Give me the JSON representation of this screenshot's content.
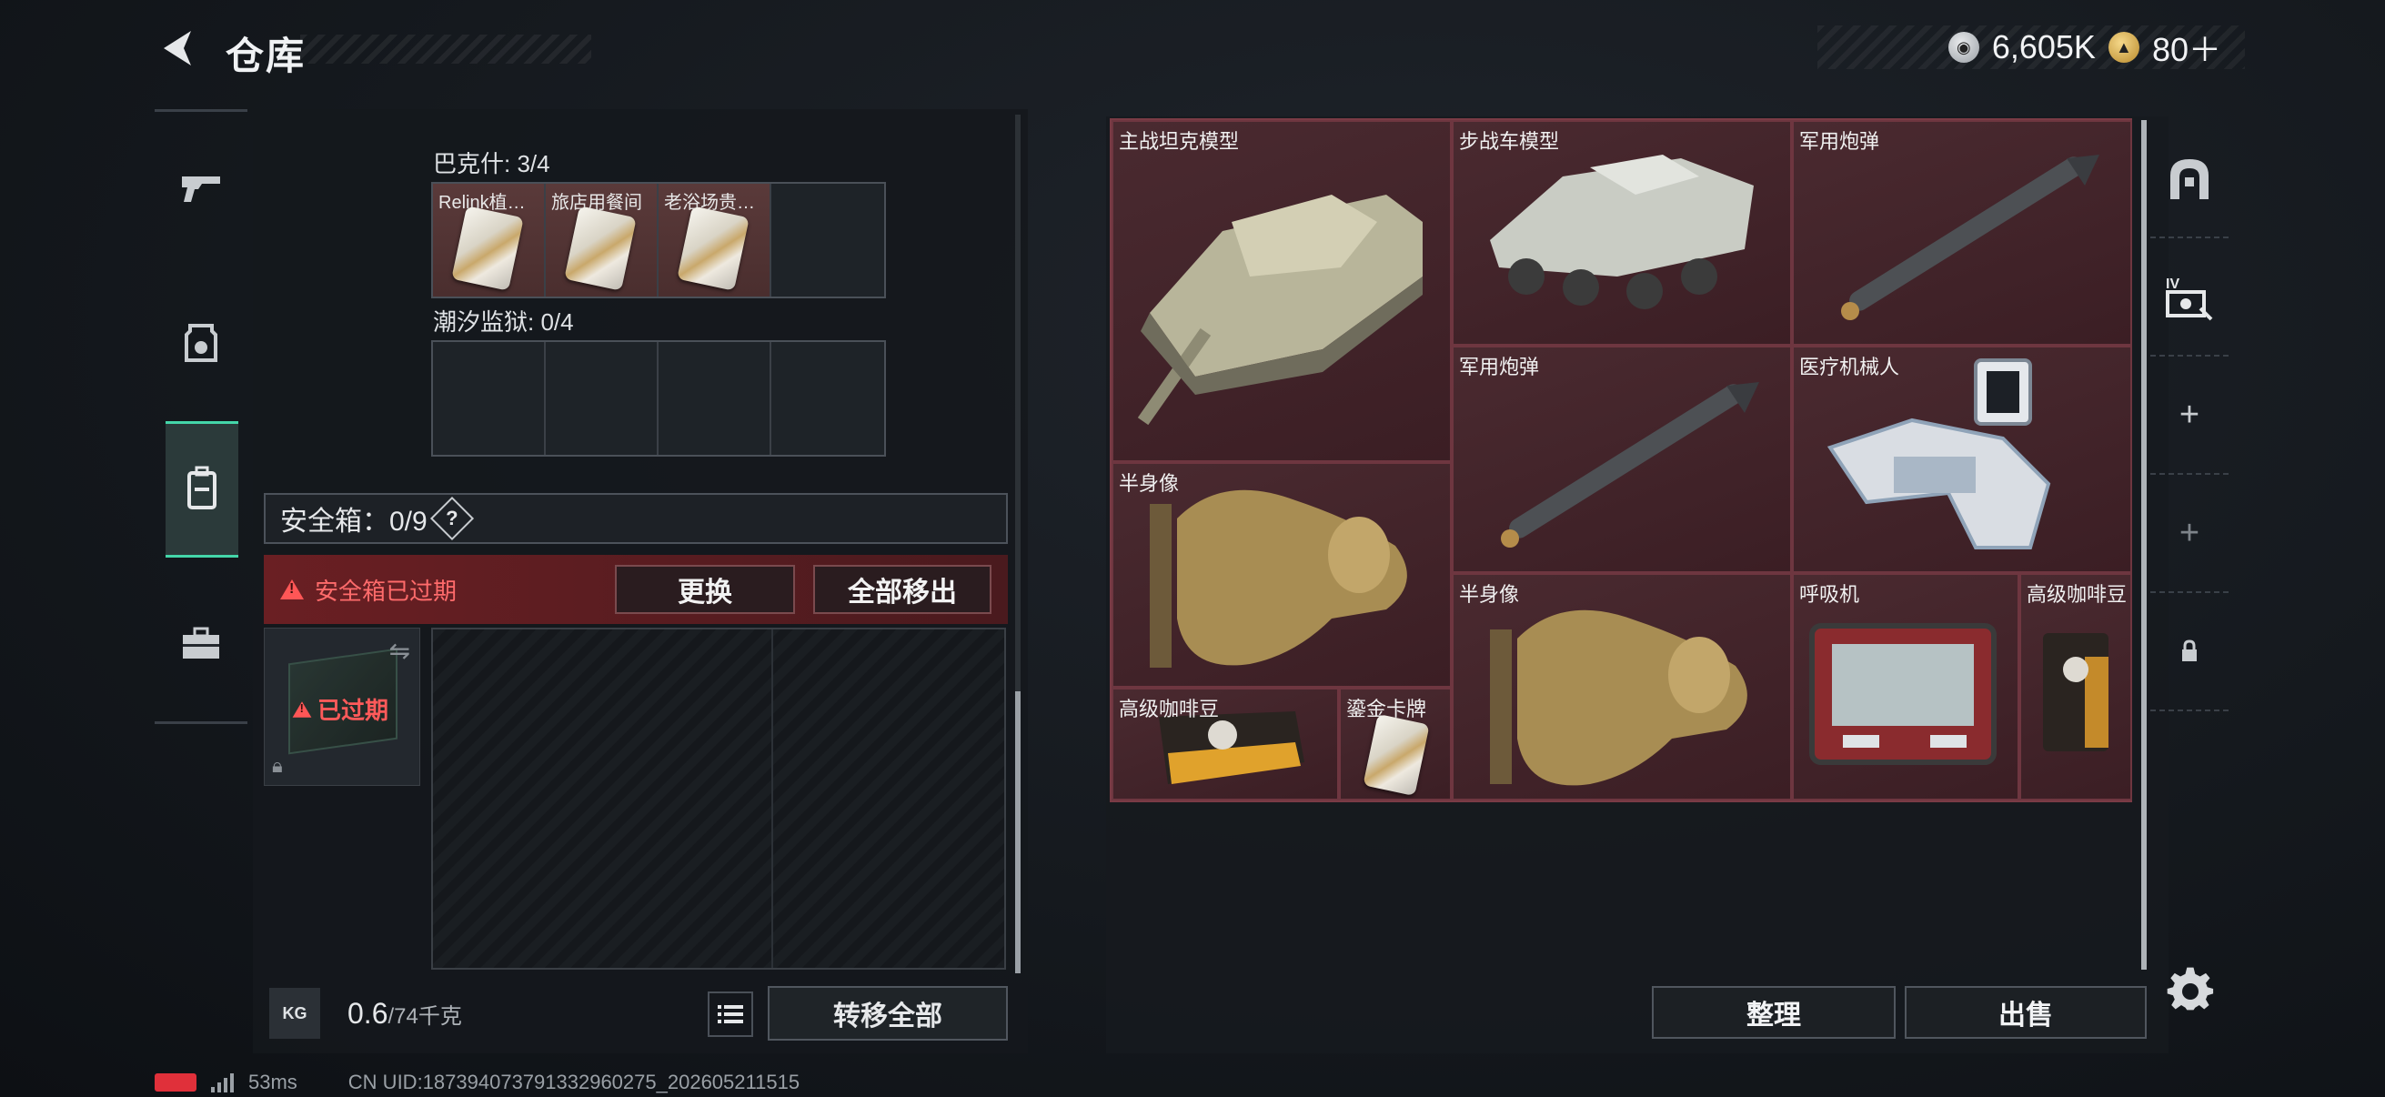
{
  "header": {
    "title": "仓库",
    "currencies": [
      {
        "icon": "silver-coin-icon",
        "value": "6,605K"
      },
      {
        "icon": "gold-coin-icon",
        "value": "80＋"
      }
    ]
  },
  "left_sidebar": {
    "items": [
      {
        "name": "weapons",
        "icon": "pistol-icon"
      },
      {
        "name": "gear",
        "icon": "helmet-icon"
      },
      {
        "name": "backpack",
        "icon": "backpack-icon",
        "active": true
      },
      {
        "name": "tools",
        "icon": "toolbox-icon"
      }
    ]
  },
  "collections": [
    {
      "label": "巴克什: 3/4",
      "slots": [
        "Relink植…",
        "旅店用餐间",
        "老浴场贵…",
        ""
      ]
    },
    {
      "label": "潮汐监狱: 0/4",
      "slots": [
        "",
        "",
        "",
        ""
      ]
    }
  ],
  "safe_box": {
    "label": "安全箱：0/9",
    "help": "?",
    "expired_notice": "安全箱已过期",
    "replace_label": "更换",
    "remove_all_label": "全部移出",
    "case_status": "已过期"
  },
  "weight": {
    "icon_label": "KG",
    "current": "0.6",
    "capacity": "/74千克",
    "transfer_all_label": "转移全部"
  },
  "stash_items": [
    {
      "name": "主战坦克模型",
      "art": "tank"
    },
    {
      "name": "步战车模型",
      "art": "ifv"
    },
    {
      "name": "军用炮弹",
      "art": "missile"
    },
    {
      "name": "军用炮弹",
      "art": "missile"
    },
    {
      "name": "医疗机械人",
      "art": "robot"
    },
    {
      "name": "半身像",
      "art": "bust"
    },
    {
      "name": "半身像",
      "art": "bust"
    },
    {
      "name": "呼吸机",
      "art": "ventilator"
    },
    {
      "name": "高级咖啡豆",
      "art": "coffee"
    },
    {
      "name": "高级咖啡豆",
      "art": "coffee"
    },
    {
      "name": "鎏金卡牌",
      "art": "card"
    }
  ],
  "right_actions": {
    "sort_label": "整理",
    "sell_label": "出售"
  },
  "right_sidebar": {
    "items": [
      "arch-icon",
      "iv-scanner-icon",
      "plus-icon",
      "plus-icon",
      "lock-icon"
    ],
    "plus": "+"
  },
  "status_bar": {
    "ping": "53ms",
    "uid": "CN UID:187394073791332960275_202605211515"
  },
  "colors": {
    "accent": "#44d6a9",
    "item_bg": "#4a2a30",
    "warning": "#ff5656"
  }
}
